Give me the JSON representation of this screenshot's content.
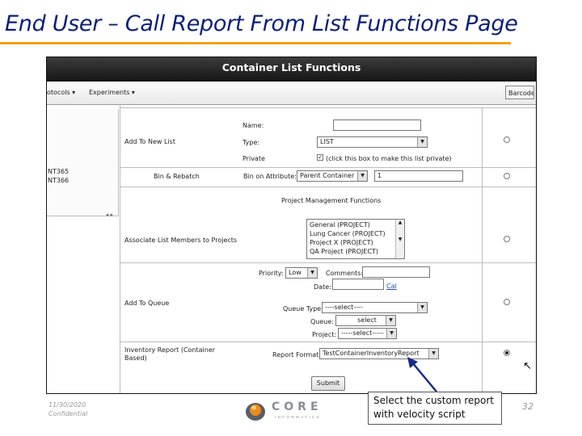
{
  "slide": {
    "title": "End User – Call Report From List Functions Page",
    "footer_date": "11/30/2020",
    "footer_confidential": "Confidential",
    "page_number": "32",
    "callout": "Select the custom report with velocity script",
    "logo_word": "CORE",
    "logo_sub": "INFORMATICS",
    "accent_color": "#f2a00f",
    "title_color": "#0a1f7a"
  },
  "screenshot": {
    "header": "Container List Functions",
    "menu": [
      "otocols ▾",
      "Experiments ▾"
    ],
    "barcode_button": "Barcode",
    "left_panel_items": [
      "NT365",
      "NT366"
    ],
    "left_panel_scroll": "◂ ▸",
    "rows": {
      "add_to_new_list": {
        "label": "Add To New List",
        "name_label": "Name:",
        "name_value": "",
        "type_label": "Type:",
        "type_value": "LIST",
        "private_label": "Private",
        "private_checked": true,
        "private_hint": "(click this box to make this list private)",
        "selected": false
      },
      "bin_rebatch": {
        "label": "Bin & Rebatch",
        "bin_on_label": "Bin on Attribute:",
        "bin_on_value": "Parent Container",
        "bin_count": "1",
        "selected": false
      },
      "project_mgmt_header": "Project Management Functions",
      "associate_projects": {
        "label": "Associate List Members to Projects",
        "projects": [
          "General (PROJECT)",
          "Lung Cancer (PROJECT)",
          "Project X (PROJECT)",
          "QA Project (PROJECT)"
        ],
        "selected": false
      },
      "add_to_queue": {
        "label": "Add To Queue",
        "priority_label": "Priority:",
        "priority_value": "Low",
        "comments_label": "Comments:",
        "date_label": "Date:",
        "cal_link": "Cal",
        "queue_type_label": "Queue Type:",
        "queue_type_value": "----select----",
        "queue_label": "Queue:",
        "queue_value": "select",
        "project_label": "Project:",
        "project_value": "-----select-----",
        "selected": false
      },
      "inventory_report": {
        "label_line1": "Inventory Report (Container",
        "label_line2": "Based)",
        "report_format_label": "Report Format:",
        "report_format_value": "TestContainerInventoryReport",
        "selected": true
      }
    },
    "submit_label": "Submit"
  }
}
